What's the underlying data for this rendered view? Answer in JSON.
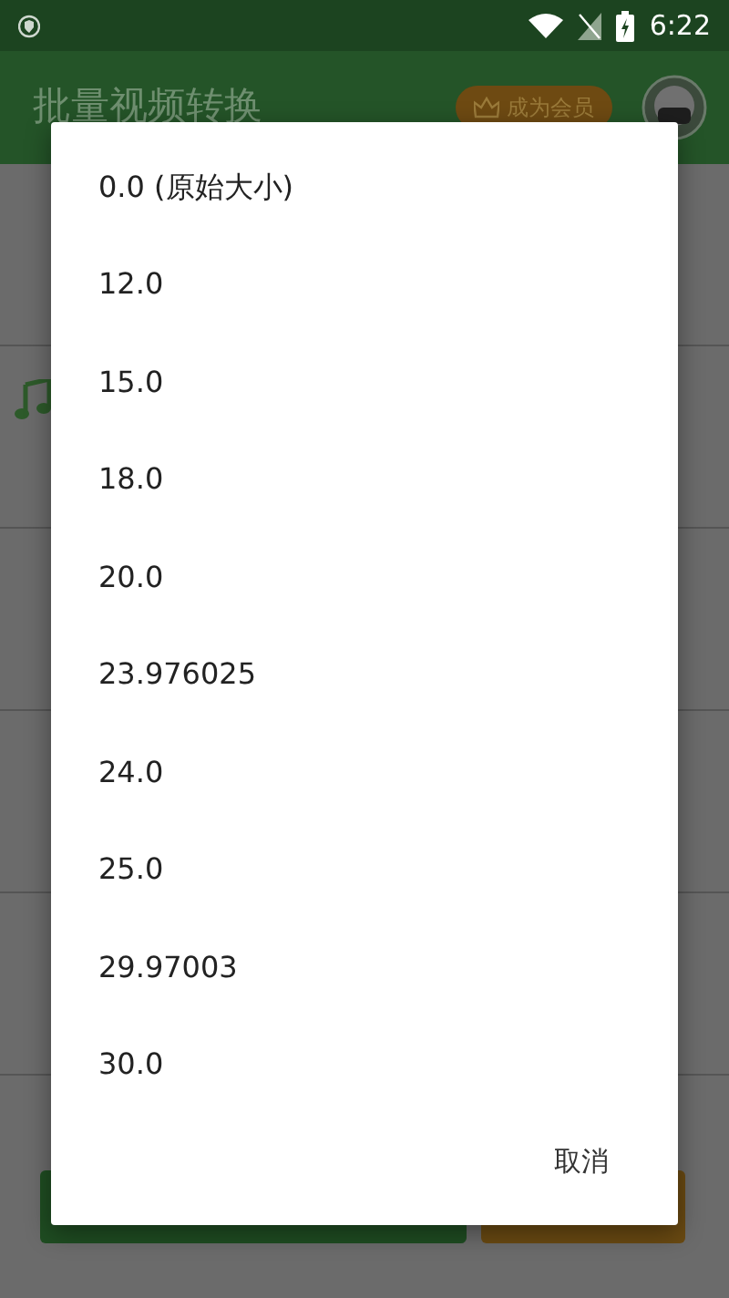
{
  "status_bar": {
    "time": "6:22"
  },
  "app_bar": {
    "title": "批量视频转换",
    "vip_button": "成为会员"
  },
  "buttons": [
    {
      "kind": "primary"
    },
    {
      "kind": "secondary"
    }
  ],
  "dialog": {
    "options": [
      {
        "label": "0.0 (原始大小)"
      },
      {
        "label": "12.0"
      },
      {
        "label": "15.0"
      },
      {
        "label": "18.0"
      },
      {
        "label": "20.0"
      },
      {
        "label": "23.976025"
      },
      {
        "label": "24.0"
      },
      {
        "label": "25.0"
      },
      {
        "label": "29.97003"
      },
      {
        "label": "30.0"
      }
    ],
    "cancel": "取消"
  }
}
